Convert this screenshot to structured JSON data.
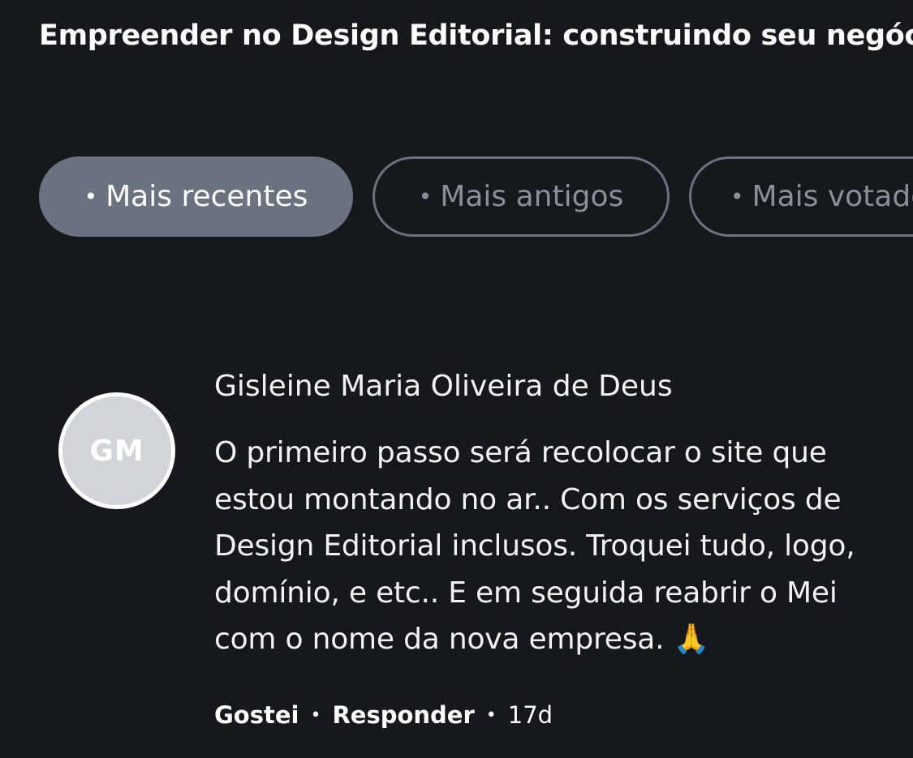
{
  "post": {
    "title": "Empreender no Design Editorial: construindo seu negócio"
  },
  "filters": {
    "bullet": "•",
    "items": [
      {
        "label": "Mais recentes",
        "active": true
      },
      {
        "label": "Mais antigos",
        "active": false
      },
      {
        "label": "Mais votados",
        "active": false
      }
    ]
  },
  "comment": {
    "avatar_initials": "GM",
    "author": "Gisleine Maria Oliveira de Deus",
    "text": "O primeiro passo será recolocar o site que estou montando no ar.. Com os serviços de Design Editorial inclusos. Troquei tudo, logo, domínio, e etc.. E em seguida reabrir o Mei com o nome da nova empresa. 🙏",
    "like_label": "Gostei",
    "reply_label": "Responder",
    "separator": "•",
    "age": "17d"
  },
  "colors": {
    "background": "#15181c",
    "chip_active": "#6b7280",
    "chip_border": "#6b7280",
    "avatar_bg": "#d1d4d8"
  }
}
